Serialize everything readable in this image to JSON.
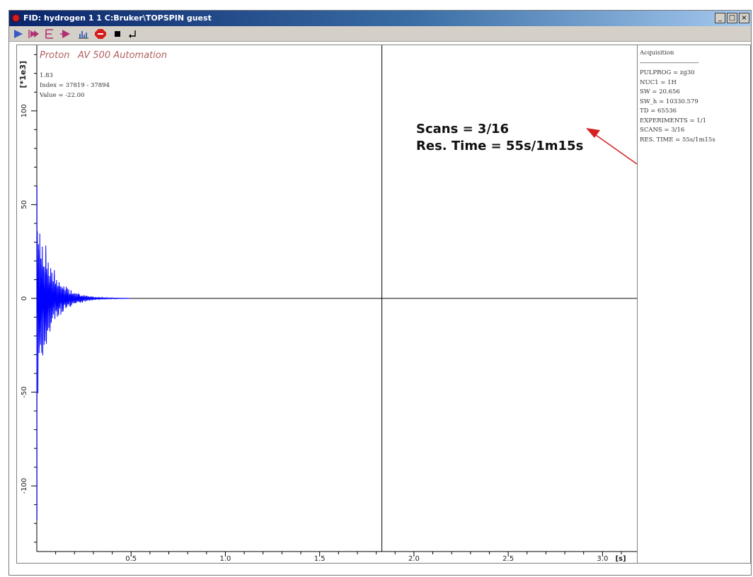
{
  "window": {
    "title": "FID: hydrogen 1 1 C:Bruker\\TOPSPIN guest",
    "controls": {
      "minimize": "_",
      "maximize": "□",
      "close": "×"
    }
  },
  "toolbar": {
    "items": [
      {
        "icon": "play-icon"
      },
      {
        "icon": "play-multi-icon"
      },
      {
        "icon": "bracket-icon"
      },
      {
        "icon": "play-alt-icon"
      },
      {
        "icon": "peaks-icon"
      },
      {
        "icon": "stop-sign-icon"
      },
      {
        "icon": "stop-square-icon"
      },
      {
        "icon": "return-icon"
      }
    ]
  },
  "plot": {
    "experiment_title": "Proton",
    "spectrometer_title": "AV 500 Automation",
    "cursor_info": [
      "1.83",
      "Index = 37819 - 37894",
      "Value = -22.00"
    ],
    "y_unit": "[*1e3]",
    "x_unit": "[s]",
    "y_ticks": [
      "100",
      "50",
      "0",
      "-50",
      "-100"
    ],
    "x_ticks": [
      "0.5",
      "1.0",
      "1.5",
      "2.0",
      "2.5",
      "3.0"
    ],
    "signal_color": "#0000ff",
    "annotation_lines": [
      "Scans = 3/16",
      "Res. Time = 55s/1m15s"
    ],
    "annotation_arrow_color": "#d62020"
  },
  "chart_data": {
    "type": "line",
    "title": "Proton   AV 500 Automation",
    "xlabel": "[s]",
    "ylabel": "[*1e3]",
    "xlim": [
      0,
      3.13
    ],
    "ylim": [
      -135,
      135
    ],
    "cursor_x": 1.83,
    "signal": "FID decaying oscillation, amplitude ~60 at t=0 decaying to ~0 by t~0.3 s",
    "envelope_amplitude": [
      60,
      15,
      3,
      0.5,
      0
    ]
  },
  "acquisition": {
    "heading": "Acquisition",
    "separator": "-----------------------------------",
    "params": [
      "PULPROG = zg30",
      "NUC1 = 1H",
      "SW = 20.656",
      "SW_h = 10330.579",
      "TD = 65536",
      "EXPERIMENTS = 1/1",
      "SCANS = 3/16",
      "RES. TIME = 55s/1m15s"
    ]
  }
}
